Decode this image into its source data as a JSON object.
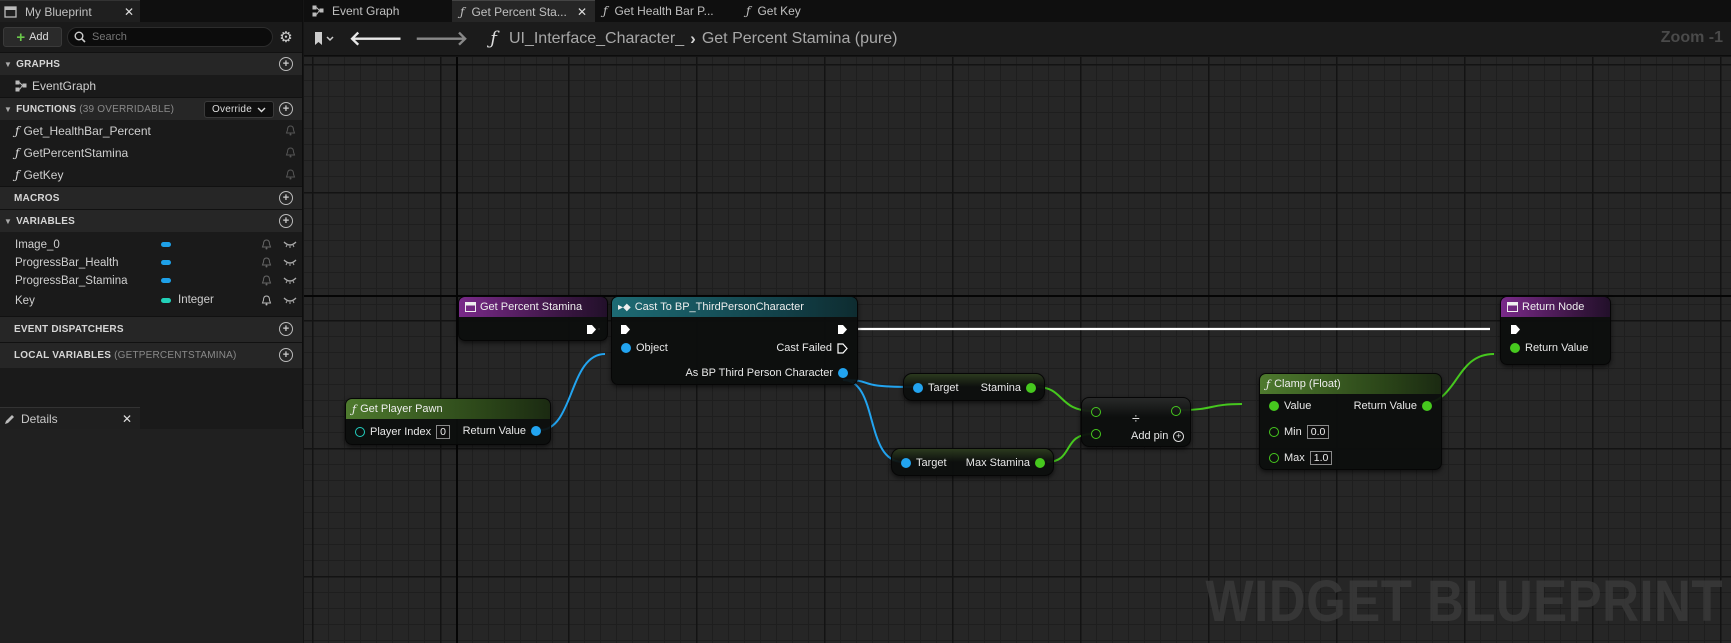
{
  "left_panel": {
    "tab_title": "My Blueprint",
    "add_label": "Add",
    "search_placeholder": "Search",
    "graphs": {
      "title": "GRAPHS",
      "items": [
        "EventGraph"
      ]
    },
    "functions": {
      "title": "FUNCTIONS",
      "sub": "(39 OVERRIDABLE)",
      "override_label": "Override",
      "items": [
        "Get_HealthBar_Percent",
        "GetPercentStamina",
        "GetKey"
      ]
    },
    "macros": {
      "title": "MACROS"
    },
    "variables": {
      "title": "VARIABLES",
      "items": [
        {
          "name": "Image_0",
          "type": "",
          "color": "#1ea0e8"
        },
        {
          "name": "ProgressBar_Health",
          "type": "",
          "color": "#1ea0e8"
        },
        {
          "name": "ProgressBar_Stamina",
          "type": "",
          "color": "#1ea0e8"
        },
        {
          "name": "Key",
          "type": "Integer",
          "color": "#22d0b8"
        }
      ]
    },
    "event_dispatchers": {
      "title": "EVENT DISPATCHERS"
    },
    "local_variables": {
      "title": "LOCAL VARIABLES",
      "sub": "(GETPERCENTSTAMINA)"
    },
    "details_title": "Details"
  },
  "editor_tabs": [
    {
      "label": "Event Graph",
      "active": false
    },
    {
      "label": "Get Percent Sta...",
      "active": true
    },
    {
      "label": "Get Health Bar P...",
      "active": false
    },
    {
      "label": "Get Key",
      "active": false
    }
  ],
  "breadcrumb": {
    "root": "UI_Interface_Character_",
    "current": "Get Percent Stamina (pure)",
    "zoom": "Zoom -1"
  },
  "graph": {
    "watermark": "WIDGET BLUEPRINT",
    "nodes": {
      "entry": {
        "title": "Get Percent Stamina"
      },
      "cast": {
        "title": "Cast To BP_ThirdPersonCharacter",
        "object": "Object",
        "cast_failed": "Cast Failed",
        "as_bp": "As BP Third Person Character"
      },
      "get_player_pawn": {
        "title": "Get Player Pawn",
        "player_index": "Player Index",
        "player_index_value": "0",
        "return_value": "Return Value"
      },
      "stamina_get": {
        "target": "Target",
        "output": "Stamina"
      },
      "max_stamina_get": {
        "target": "Target",
        "output": "Max Stamina"
      },
      "divide": {
        "symbol": "÷",
        "add_pin": "Add pin"
      },
      "clamp": {
        "title": "Clamp (Float)",
        "value": "Value",
        "min": "Min",
        "min_value": "0.0",
        "max": "Max",
        "max_value": "1.0",
        "return_value": "Return Value"
      },
      "return": {
        "title": "Return Node",
        "return_value": "Return Value"
      }
    }
  }
}
